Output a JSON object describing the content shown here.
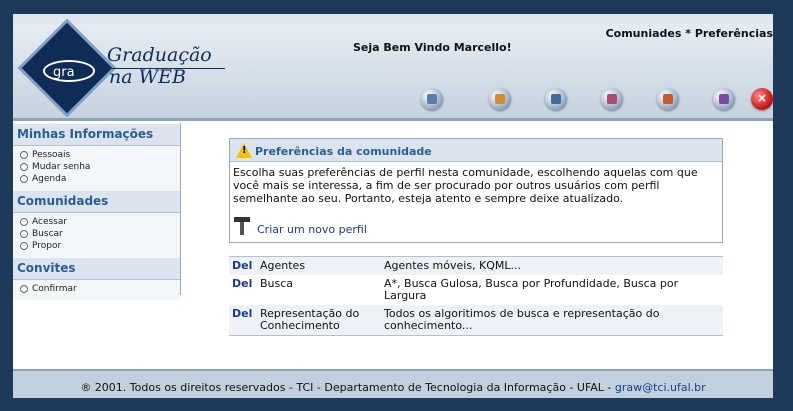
{
  "header": {
    "logo_mark": "gra",
    "logo_title_line1": "Graduação",
    "logo_title_line2": "na WEB",
    "welcome": "Seja Bem Vindo Marcello!",
    "topnav": "Comuniades * Preferências",
    "icons": [
      "users-icon",
      "edit-icon",
      "book-icon",
      "search-icon",
      "profile-icon",
      "notebook-icon",
      "close-icon"
    ],
    "icon_colors": [
      "#5b7ea8",
      "#d28a2a",
      "#3f6b9a",
      "#b04a6c",
      "#c85a2a",
      "#7a4aa0",
      "#d01a1a"
    ]
  },
  "sidebar": {
    "sections": [
      {
        "title": "Minhas Informações",
        "items": [
          "Pessoais",
          "Mudar senha",
          "Agenda"
        ]
      },
      {
        "title": "Comunidades",
        "items": [
          "Acessar",
          "Buscar",
          "Propor"
        ]
      },
      {
        "title": "Convites",
        "items": [
          "Confirmar"
        ]
      }
    ]
  },
  "panel": {
    "title": "Preferências da comunidade",
    "text": "Escolha suas preferências de perfil nesta comunidade, escolhendo aquelas com que você mais se interessa, a fim de ser procurado por outros usuários com perfil semelhante ao seu. Portanto, esteja atento e sempre deixe atualizado.",
    "create_link": "Criar um novo perfil"
  },
  "profiles": [
    {
      "action": "Del",
      "name": "Agentes",
      "details": "Agentes móveis, KQML..."
    },
    {
      "action": "Del",
      "name": "Busca",
      "details": "A*, Busca Gulosa, Busca por Profundidade, Busca por Largura"
    },
    {
      "action": "Del",
      "name": "Representação do Conhecimento",
      "details": "Todos os algoritimos de busca e representação do conhecimento..."
    }
  ],
  "footer": {
    "text": "® 2001. Todos os direitos reservados - TCI - Departamento de Tecnologia da Informação - UFAL - ",
    "email": "graw@tci.ufal.br"
  },
  "colors": {
    "accent": "#2b5d96",
    "link": "#1a3d8f",
    "outer_background": "#1e3a5a"
  }
}
